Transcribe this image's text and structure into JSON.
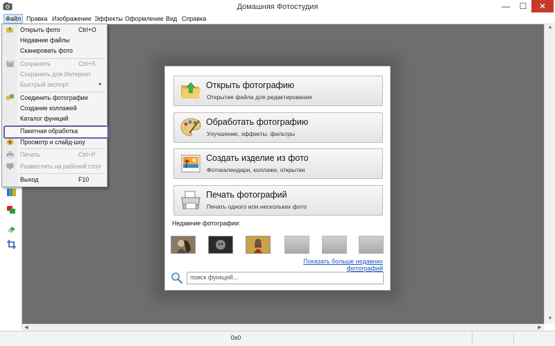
{
  "window": {
    "title": "Домашняя Фотостудия",
    "controls": {
      "minimize": "—",
      "maximize": "☐",
      "close": "✕"
    }
  },
  "menubar": [
    "Файл",
    "Правка",
    "Изображение",
    "Эффекты",
    "Оформление",
    "Вид",
    "Справка"
  ],
  "file_menu": {
    "items": [
      {
        "label": "Открыть фото",
        "shortcut": "Ctrl+O",
        "enabled": true,
        "icon": "folder-open-icon"
      },
      {
        "label": "Недавние файлы",
        "shortcut": "",
        "enabled": true,
        "icon": ""
      },
      {
        "label": "Сканировать фото",
        "shortcut": "",
        "enabled": true,
        "icon": ""
      },
      {
        "label": "Сохранить",
        "shortcut": "Ctrl+S",
        "enabled": false,
        "icon": "save-icon"
      },
      {
        "label": "Сохранить для Интернет",
        "shortcut": "",
        "enabled": false,
        "icon": ""
      },
      {
        "label": "Быстрый экспорт",
        "shortcut": "",
        "enabled": false,
        "icon": "",
        "submenu": "▸"
      },
      {
        "label": "Соединить фотографии",
        "shortcut": "",
        "enabled": true,
        "icon": "join-photos-icon"
      },
      {
        "label": "Создание коллажей",
        "shortcut": "",
        "enabled": true,
        "icon": ""
      },
      {
        "label": "Каталог функций",
        "shortcut": "",
        "enabled": true,
        "icon": ""
      },
      {
        "label": "Пакетная обработка",
        "shortcut": "",
        "enabled": true,
        "icon": "",
        "highlighted": true
      },
      {
        "label": "Просмотр и слайд-шоу",
        "shortcut": "",
        "enabled": true,
        "icon": "slideshow-icon"
      },
      {
        "label": "Печать",
        "shortcut": "Ctrl+P",
        "enabled": false,
        "icon": "printer-icon"
      },
      {
        "label": "Разместить на рабочий стол",
        "shortcut": "",
        "enabled": false,
        "icon": "desktop-icon"
      },
      {
        "label": "Выход",
        "shortcut": "F10",
        "enabled": true,
        "icon": ""
      }
    ]
  },
  "start_dialog": {
    "actions": [
      {
        "title": "Открыть фотографию",
        "subtitle": "Открытие файла для редактирования",
        "icon": "open-folder-icon"
      },
      {
        "title": "Обработать фотографию",
        "subtitle": "Улучшение, эффекты, фильтры",
        "icon": "palette-icon"
      },
      {
        "title": "Создать изделие из фото",
        "subtitle": "Фотокалендари, коллажи, открытки",
        "icon": "photo-product-icon"
      },
      {
        "title": "Печать фотографий",
        "subtitle": "Печать одного или нескольких фото",
        "icon": "printer-icon"
      }
    ],
    "recent_label": "Недавние фотографии:",
    "more_link": "Показать больше недавних фотографий",
    "search_placeholder": "поиск функций..."
  },
  "status": {
    "dimensions": "0x0"
  },
  "colors": {
    "workspace": "#6e6e6e",
    "highlight": "#6b5fa7",
    "link": "#1c54c4",
    "close": "#c7392c"
  }
}
